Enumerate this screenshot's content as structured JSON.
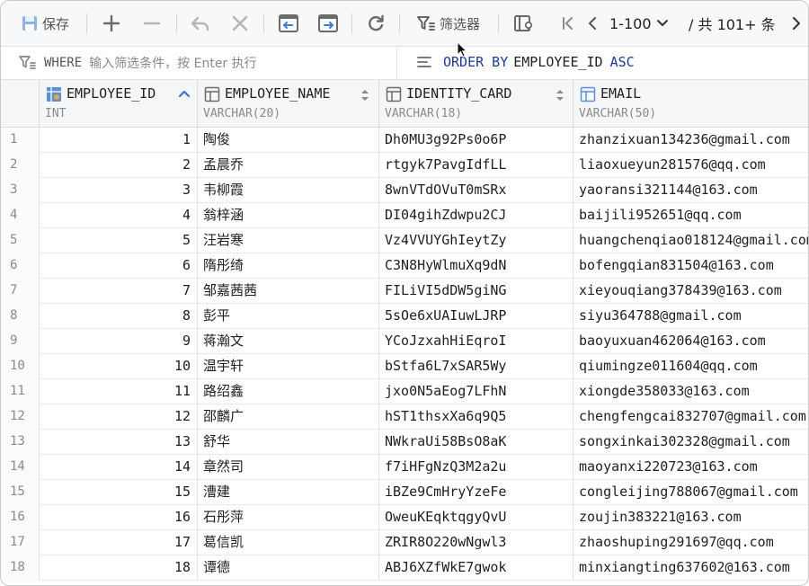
{
  "toolbar": {
    "save_label": "保存",
    "filter_label": "筛选器",
    "page_range": "1-100",
    "total_label": "/ 共 101+ 条"
  },
  "filter": {
    "where_keyword": "WHERE",
    "where_placeholder": "输入筛选条件，按 Enter 执行",
    "order_keyword": "ORDER BY",
    "order_column": "EMPLOYEE_ID",
    "order_direction": "ASC"
  },
  "columns": [
    {
      "name": "EMPLOYEE_ID",
      "type": "INT",
      "icon": "primary-key-column-icon",
      "sort": "asc"
    },
    {
      "name": "EMPLOYEE_NAME",
      "type": "VARCHAR(20)",
      "icon": "column-icon",
      "sort": "none"
    },
    {
      "name": "IDENTITY_CARD",
      "type": "VARCHAR(18)",
      "icon": "column-icon",
      "sort": "none"
    },
    {
      "name": "EMAIL",
      "type": "VARCHAR(50)",
      "icon": "column-icon",
      "sort": "none"
    }
  ],
  "rows": [
    {
      "n": "1",
      "id": "1",
      "name": "陶俊",
      "card": "Dh0MU3g92Ps0o6P",
      "email": "zhanzixuan134236@gmail.com"
    },
    {
      "n": "2",
      "id": "2",
      "name": "孟晨乔",
      "card": "rtgyk7PavgIdfLL",
      "email": "liaoxueyun281576@qq.com"
    },
    {
      "n": "3",
      "id": "3",
      "name": "韦柳霞",
      "card": "8wnVTdOVuT0mSRx",
      "email": "yaoransi321144@163.com"
    },
    {
      "n": "4",
      "id": "4",
      "name": "翁梓涵",
      "card": "DI04gihZdwpu2CJ",
      "email": "baijili952651@qq.com"
    },
    {
      "n": "5",
      "id": "5",
      "name": "汪岩寒",
      "card": "Vz4VVUYGhIeytZy",
      "email": "huangchenqiao018124@gmail.com"
    },
    {
      "n": "6",
      "id": "6",
      "name": "隋彤绮",
      "card": "C3N8HyWlmuXq9dN",
      "email": "bofengqian831504@163.com"
    },
    {
      "n": "7",
      "id": "7",
      "name": "邹嘉茜茜",
      "card": "FILiVI5dDW5giNG",
      "email": "xieyouqiang378439@163.com"
    },
    {
      "n": "8",
      "id": "8",
      "name": "彭平",
      "card": "5sOe6xUAIuwLJRP",
      "email": "siyu364788@gmail.com"
    },
    {
      "n": "9",
      "id": "9",
      "name": "蒋瀚文",
      "card": "YCoJzxahHiEqroI",
      "email": "baoyuxuan462064@163.com"
    },
    {
      "n": "10",
      "id": "10",
      "name": "温宇轩",
      "card": "bStfa6L7xSAR5Wy",
      "email": "qiumingze011604@qq.com"
    },
    {
      "n": "11",
      "id": "11",
      "name": "路绍鑫",
      "card": "jxo0N5aEog7LFhN",
      "email": "xiongde358033@163.com"
    },
    {
      "n": "12",
      "id": "12",
      "name": "邵麟广",
      "card": "hST1thsxXa6q9Q5",
      "email": "chengfengcai832707@gmail.com"
    },
    {
      "n": "13",
      "id": "13",
      "name": "舒华",
      "card": "NWkraUi58BsO8aK",
      "email": "songxinkai302328@gmail.com"
    },
    {
      "n": "14",
      "id": "14",
      "name": "章然司",
      "card": "f7iHFgNzQ3M2a2u",
      "email": "maoyanxi220723@163.com"
    },
    {
      "n": "15",
      "id": "15",
      "name": "漕建",
      "card": "iBZe9CmHryYzeFe",
      "email": "congleijing788067@gmail.com"
    },
    {
      "n": "16",
      "id": "16",
      "name": "石彤萍",
      "card": "OweuKEqktqgyQvU",
      "email": "zoujin383221@163.com"
    },
    {
      "n": "17",
      "id": "17",
      "name": "葛信凯",
      "card": "ZRIR8O220wNgwl3",
      "email": "zhaoshuping291697@qq.com"
    },
    {
      "n": "18",
      "id": "18",
      "name": "谭德",
      "card": "ABJ6XZfWkE7gwok",
      "email": "minxiangting637602@163.com"
    }
  ]
}
